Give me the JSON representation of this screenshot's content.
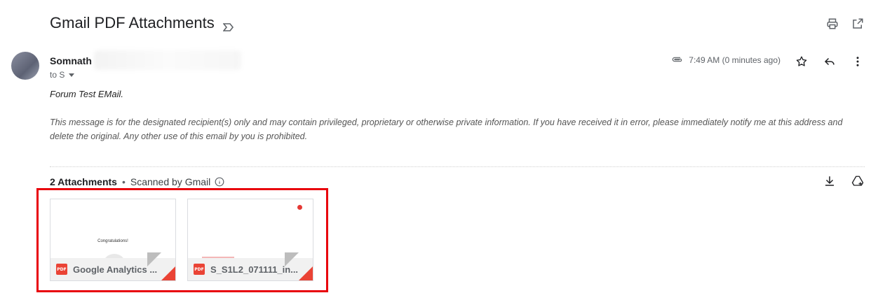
{
  "header": {
    "subject": "Gmail PDF Attachments",
    "icons": {
      "importance": "importance-marker-icon",
      "print": "print-icon",
      "open_new_window": "open-in-new-icon"
    }
  },
  "message": {
    "sender_name": "Somnath",
    "recipient": "to S",
    "time": "7:49 AM (0 minutes ago)",
    "body": "Forum Test EMail.",
    "disclaimer": "This message is for the designated recipient(s) only and may contain privileged, proprietary or otherwise private information. If you have received it in error, please immediately notify me at this address and delete the original. Any other use of this email by you is prohibited.",
    "icons": {
      "attachment": "paperclip-icon",
      "star": "star-icon",
      "reply": "reply-icon",
      "more": "more-vert-icon"
    }
  },
  "attachments": {
    "count_label": "2 Attachments",
    "separator": "•",
    "scanned_label": "Scanned by Gmail",
    "icons": {
      "info": "info-icon",
      "download": "download-icon",
      "add_to_drive": "add-to-drive-icon"
    },
    "items": [
      {
        "name": "Google Analytics ...",
        "type": "PDF",
        "preview_text": "Congratulations!"
      },
      {
        "name": "S_S1L2_071111_in...",
        "type": "PDF"
      }
    ]
  },
  "colors": {
    "highlight": "#e8000b",
    "pdf_red": "#ea4335",
    "text_primary": "#202124",
    "text_secondary": "#5f6368"
  }
}
